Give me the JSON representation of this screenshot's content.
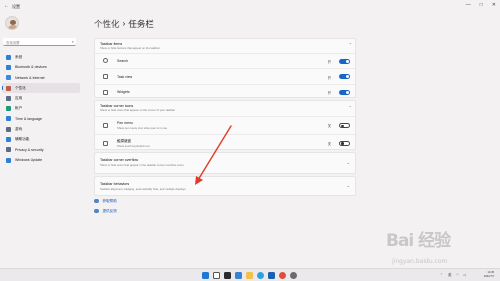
{
  "titlebar": {
    "app": "设置",
    "back": "←",
    "minimize": "—",
    "maximize": "□",
    "close": "✕"
  },
  "sidebar": {
    "search_placeholder": "查找设置",
    "items": [
      {
        "label": "系统",
        "color": "#2f7fd8"
      },
      {
        "label": "Bluetooth & devices",
        "color": "#2f7fd8"
      },
      {
        "label": "Network & internet",
        "color": "#3c8be0"
      },
      {
        "label": "个性化",
        "color": "#c05b4a",
        "active": true
      },
      {
        "label": "应用",
        "color": "#5a6a88"
      },
      {
        "label": "帐户",
        "color": "#1e9a7a"
      },
      {
        "label": "Time & language",
        "color": "#2f7fd8"
      },
      {
        "label": "游戏",
        "color": "#5a6a88"
      },
      {
        "label": "辅助功能",
        "color": "#2f7fd8"
      },
      {
        "label": "Privacy & security",
        "color": "#5a6a88"
      },
      {
        "label": "Windows Update",
        "color": "#2f7fd8"
      }
    ]
  },
  "breadcrumb": {
    "parent": "个性化",
    "separator": "›",
    "current": "任务栏"
  },
  "taskbar_items": {
    "title": "Taskbar items",
    "subtitle": "Show or hide buttons that appear on the taskbar",
    "rows": [
      {
        "label": "Search",
        "state": "开",
        "on": true
      },
      {
        "label": "Task view",
        "state": "开",
        "on": true
      },
      {
        "label": "Widgets",
        "state": "开",
        "on": true
      }
    ]
  },
  "corner_icons": {
    "title": "Taskbar corner icons",
    "subtitle": "Show or hide icons that appear on the corner of your taskbar",
    "rows": [
      {
        "label": "Pen menu",
        "sub": "Show pen menu icon when pen is in use",
        "state": "关",
        "on": false
      },
      {
        "label": "触摸键盘",
        "sub": "Show touch keyboard icon",
        "state": "关",
        "on": false
      }
    ]
  },
  "corner_overflow": {
    "title": "Taskbar corner overflow",
    "subtitle": "Show or hide icons that appear in the taskbar corner overflow menu"
  },
  "behaviors": {
    "title": "Taskbar behaviors",
    "subtitle": "Taskbar alignment, badging, automatically hide, and multiple displays"
  },
  "links": {
    "help": "获取帮助",
    "feedback": "提供反馈"
  },
  "tray": {
    "lang": "英",
    "time": "14:45",
    "date": "2021/7/7"
  },
  "watermark": {
    "brand": "Bai 经验",
    "url": "jingyan.baidu.com"
  },
  "colors": {
    "accent": "#1766c9",
    "annotation_arrow": "#e03a2a"
  }
}
